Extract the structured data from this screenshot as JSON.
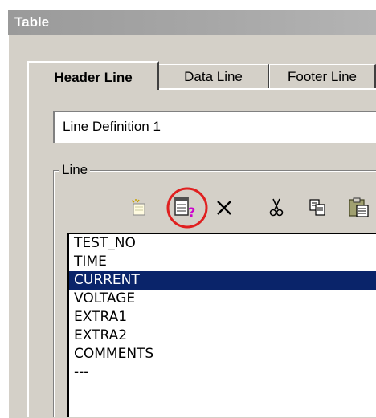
{
  "window": {
    "title": "Table"
  },
  "tabs": [
    {
      "label": "Header Line",
      "active": true
    },
    {
      "label": "Data Line",
      "active": false
    },
    {
      "label": "Footer Line",
      "active": false
    }
  ],
  "line_definition": {
    "value": "Line Definition  1"
  },
  "group": {
    "label": "Line"
  },
  "toolbar": {
    "icons": [
      "new-line-icon",
      "line-properties-icon",
      "delete-icon",
      "cut-icon",
      "copy-icon",
      "paste-icon"
    ]
  },
  "highlight": {
    "color": "#e02020",
    "target": "line-properties-icon"
  },
  "list": {
    "items": [
      "TEST_NO",
      "TIME",
      "CURRENT",
      "VOLTAGE",
      "EXTRA1",
      "EXTRA2",
      "COMMENTS",
      "---"
    ],
    "selected_index": 2,
    "selected_color": "#0a246a"
  },
  "colors": {
    "dialog_bg": "#d4d0c8",
    "accent": "#e02020"
  }
}
